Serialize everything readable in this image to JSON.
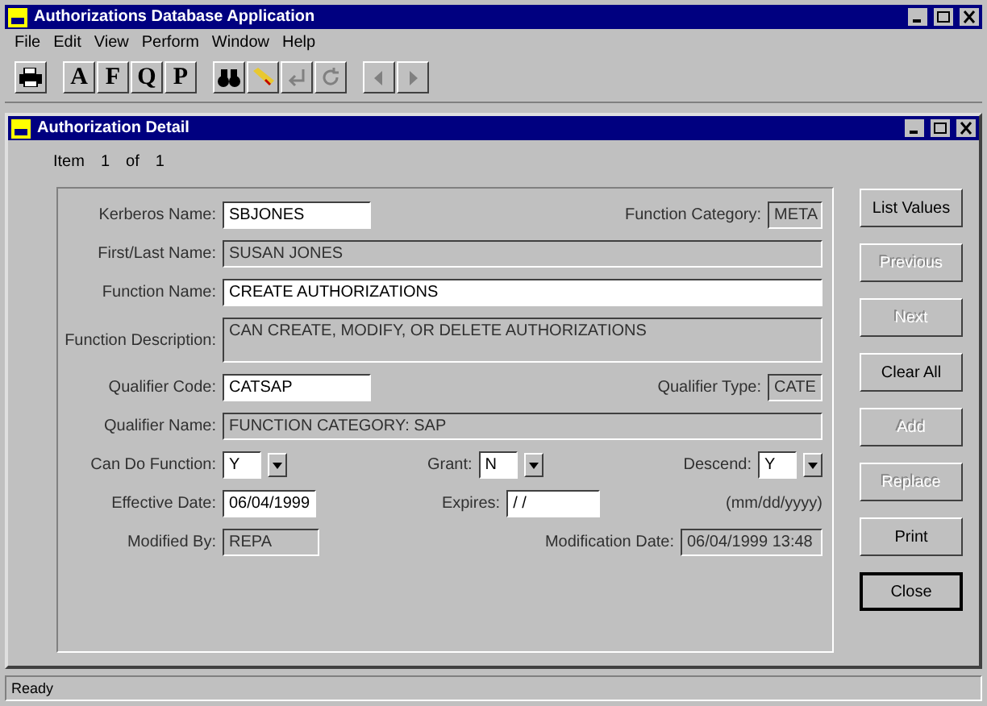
{
  "window": {
    "title": "Authorizations Database Application"
  },
  "menu": [
    "File",
    "Edit",
    "View",
    "Perform",
    "Window",
    "Help"
  ],
  "toolbar": [
    [
      {
        "kind": "printer",
        "disabled": false
      }
    ],
    [
      {
        "kind": "letter",
        "label": "A",
        "disabled": false
      },
      {
        "kind": "letter",
        "label": "F",
        "disabled": false
      },
      {
        "kind": "letter",
        "label": "Q",
        "disabled": false
      },
      {
        "kind": "letter",
        "label": "P",
        "disabled": false
      }
    ],
    [
      {
        "kind": "binoculars",
        "disabled": false
      },
      {
        "kind": "eraser",
        "disabled": false
      },
      {
        "kind": "undo",
        "disabled": true
      },
      {
        "kind": "refresh",
        "disabled": true
      }
    ],
    [
      {
        "kind": "left",
        "disabled": true
      },
      {
        "kind": "right",
        "disabled": true
      }
    ]
  ],
  "child_window": {
    "title": "Authorization Detail",
    "item_label": "Item",
    "item_index": "1",
    "item_of": "of",
    "item_total": "1"
  },
  "form": [
    {
      "fields": [
        {
          "label": "Kerberos Name:",
          "value": "SBJONES",
          "kind": "text",
          "editable": true
        },
        {
          "label": "Function Category:",
          "value": "META",
          "kind": "tiny",
          "editable": false
        }
      ]
    },
    {
      "fields": [
        {
          "label": "First/Last Name:",
          "value": "SUSAN JONES",
          "kind": "wide",
          "editable": false
        }
      ]
    },
    {
      "fields": [
        {
          "label": "Function Name:",
          "value": "CREATE AUTHORIZATIONS",
          "kind": "wide",
          "editable": true
        }
      ]
    },
    {
      "fields": [
        {
          "label": "Function Description:",
          "value": "CAN CREATE, MODIFY, OR DELETE AUTHORIZATIONS",
          "kind": "memo",
          "editable": false
        }
      ]
    },
    {
      "fields": [
        {
          "label": "Qualifier Code:",
          "value": "CATSAP",
          "kind": "text",
          "editable": true
        },
        {
          "label": "Qualifier Type:",
          "value": "CATE",
          "kind": "tiny",
          "editable": false
        }
      ]
    },
    {
      "fields": [
        {
          "label": "Qualifier Name:",
          "value": "FUNCTION CATEGORY: SAP",
          "kind": "wide",
          "editable": false
        }
      ]
    },
    {
      "fields": [
        {
          "label": "Can Do Function:",
          "value": "Y",
          "kind": "combo",
          "editable": true
        },
        {
          "label": "Grant:",
          "value": "N",
          "kind": "combo",
          "editable": true
        },
        {
          "label": "Descend:",
          "value": "Y",
          "kind": "combo",
          "editable": true
        }
      ]
    },
    {
      "fields": [
        {
          "label": "Effective Date:",
          "value": "06/04/1999",
          "kind": "date",
          "editable": true
        },
        {
          "label": "Expires:",
          "value": "/ /",
          "kind": "date",
          "editable": true
        },
        {
          "label": "(mm/dd/yyyy)",
          "kind": "note"
        }
      ]
    },
    {
      "fields": [
        {
          "label": "Modified By:",
          "value": "REPA",
          "kind": "short",
          "editable": false
        },
        {
          "label": "Modification Date:",
          "value": "06/04/1999 13:48",
          "kind": "stamp",
          "editable": false
        }
      ]
    }
  ],
  "buttons": [
    {
      "label": "List Values",
      "disabled": false,
      "default": false
    },
    {
      "label": "Previous",
      "disabled": true,
      "default": false
    },
    {
      "label": "Next",
      "disabled": true,
      "default": false
    },
    {
      "label": "Clear All",
      "disabled": false,
      "default": false
    },
    {
      "label": "Add",
      "disabled": true,
      "default": false
    },
    {
      "label": "Replace",
      "disabled": true,
      "default": false
    },
    {
      "label": "Print",
      "disabled": false,
      "default": false
    },
    {
      "label": "Close",
      "disabled": false,
      "default": true
    }
  ],
  "status_bar": "Ready"
}
